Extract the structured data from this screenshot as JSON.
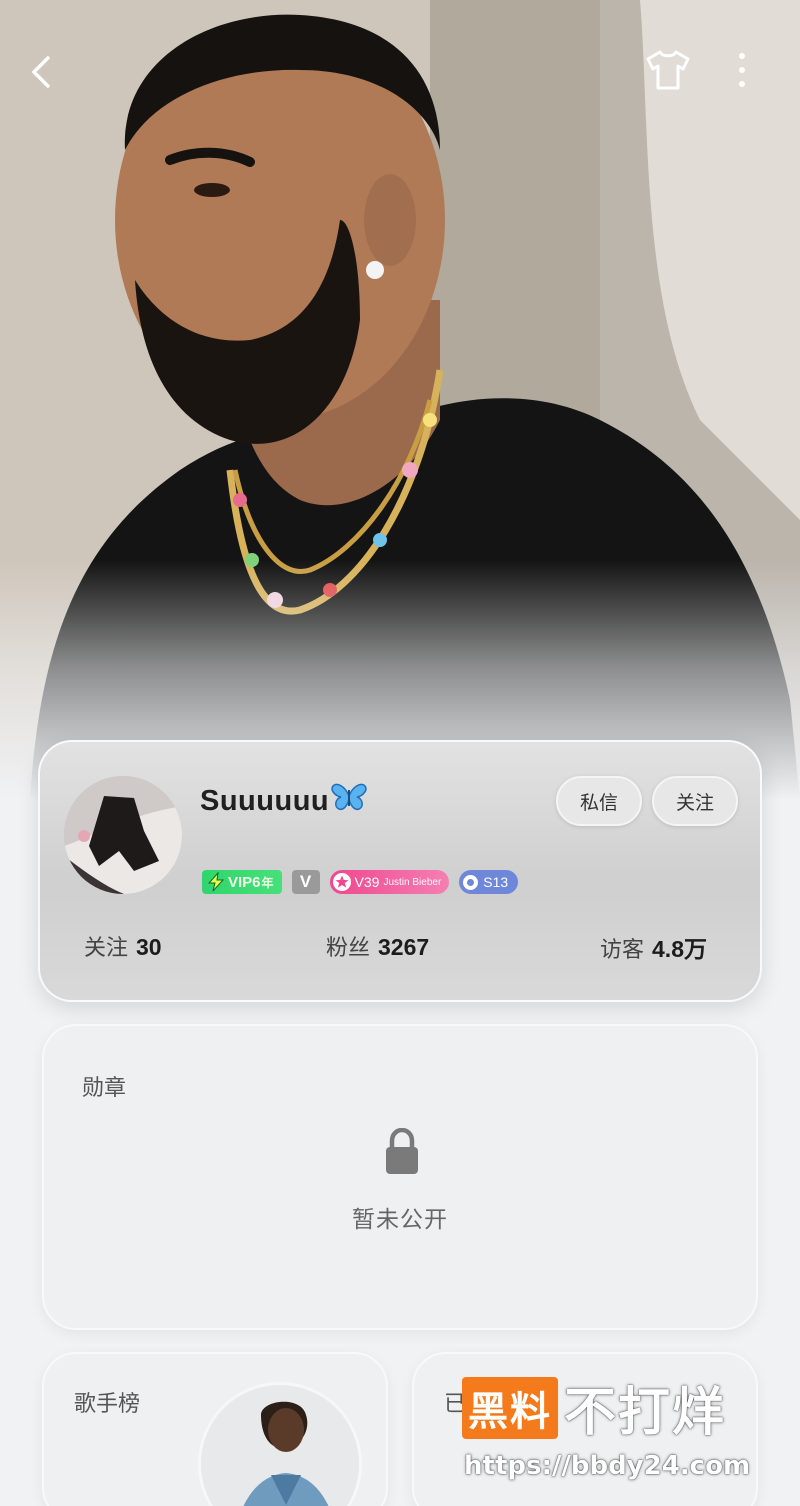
{
  "topbar": {
    "back_icon": "chevron-left-icon",
    "outfit_icon": "tshirt-icon",
    "more_icon": "more-vertical-icon"
  },
  "profile": {
    "username": "Suuuuuu",
    "username_emoji": "butterfly-icon",
    "dm_label": "私信",
    "follow_label": "关注",
    "badges": {
      "vip": "VIP6",
      "vip_suffix": "年",
      "v": "V",
      "star_level": "V39",
      "star_artist": "Justin Bieber",
      "season": "S13"
    },
    "stats": {
      "following_label": "关注",
      "following_value": "30",
      "fans_label": "粉丝",
      "fans_value": "3267",
      "visitors_label": "访客",
      "visitors_value": "4.8万"
    }
  },
  "medals": {
    "title": "勋章",
    "status": "暂未公开"
  },
  "singer_chart": {
    "title": "歌手榜"
  },
  "other_card": {
    "title": "已"
  },
  "watermark": {
    "brand_box": "黑料",
    "brand_text": "不打烊",
    "url": "https://bbdy24.com"
  },
  "colors": {
    "vip_green": "#2fd66b",
    "star_pink": "#f0478f",
    "season_blue": "#6f87d8",
    "watermark_orange": "#f47a1b"
  }
}
